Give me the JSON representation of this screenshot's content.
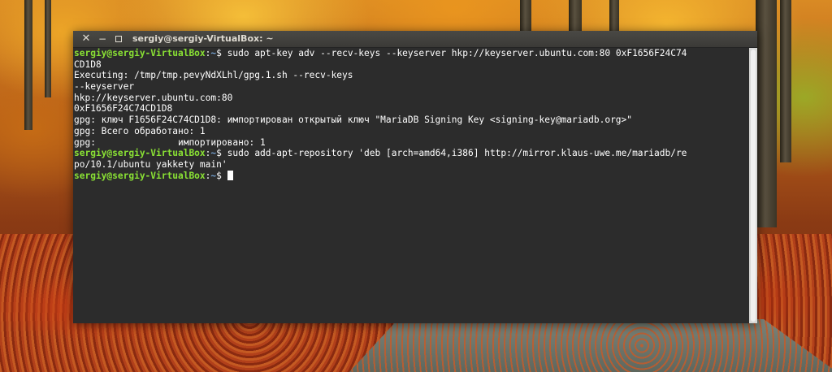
{
  "window": {
    "title": "sergiy@sergiy-VirtualBox: ~",
    "close_glyph": "✕",
    "minimize_glyph": "−"
  },
  "terminal": {
    "prompt": {
      "user": "sergiy@sergiy-VirtualBox",
      "sep": ":",
      "path": "~",
      "sym": "$"
    },
    "lines": [
      {
        "type": "prompt",
        "cmd": " sudo apt-key adv --recv-keys --keyserver hkp://keyserver.ubuntu.com:80 0xF1656F24C74"
      },
      {
        "type": "output",
        "text": "CD1D8"
      },
      {
        "type": "output",
        "text": "Executing: /tmp/tmp.pevyNdXLhl/gpg.1.sh --recv-keys"
      },
      {
        "type": "output",
        "text": "--keyserver"
      },
      {
        "type": "output",
        "text": "hkp://keyserver.ubuntu.com:80"
      },
      {
        "type": "output",
        "text": "0xF1656F24C74CD1D8"
      },
      {
        "type": "output",
        "text": "gpg: ключ F1656F24C74CD1D8: импортирован открытый ключ \"MariaDB Signing Key <signing-key@mariadb.org>\""
      },
      {
        "type": "output",
        "text": "gpg: Всего обработано: 1"
      },
      {
        "type": "output",
        "text": "gpg:               импортировано: 1"
      },
      {
        "type": "prompt",
        "cmd": " sudo add-apt-repository 'deb [arch=amd64,i386] http://mirror.klaus-uwe.me/mariadb/re"
      },
      {
        "type": "output",
        "text": "po/10.1/ubuntu yakkety main'"
      },
      {
        "type": "prompt",
        "cmd": " ",
        "cursor": true
      }
    ]
  },
  "colors": {
    "terminal_bg": "#2c2c2c",
    "prompt_user": "#8ae234",
    "prompt_path": "#729fcf",
    "text": "#ffffff",
    "titlebar": "#3b3a37"
  },
  "icons": {
    "close": "close-icon",
    "minimize": "minimize-icon",
    "maximize": "maximize-icon"
  }
}
